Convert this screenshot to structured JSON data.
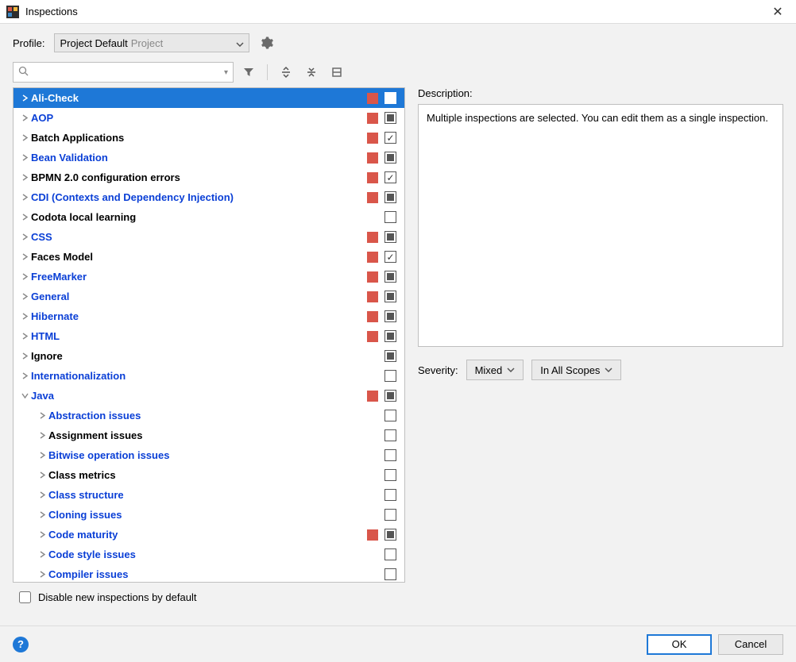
{
  "title": "Inspections",
  "profile": {
    "label": "Profile:",
    "selected": "Project Default",
    "sub": "Project"
  },
  "search": {
    "placeholder": ""
  },
  "description": {
    "label": "Description:",
    "text": "Multiple inspections are selected. You can edit them as a single inspection."
  },
  "severity": {
    "label": "Severity:",
    "value": "Mixed",
    "scope": "In All Scopes"
  },
  "disable_label": "Disable new inspections by default",
  "buttons": {
    "ok": "OK",
    "cancel": "Cancel"
  },
  "tree": [
    {
      "label": "Ali-Check",
      "link": true,
      "warn": true,
      "check": "indet",
      "selected": true,
      "expanded": false
    },
    {
      "label": "AOP",
      "link": true,
      "warn": true,
      "check": "indet"
    },
    {
      "label": "Batch Applications",
      "link": false,
      "warn": true,
      "check": "checked"
    },
    {
      "label": "Bean Validation",
      "link": true,
      "warn": true,
      "check": "indet"
    },
    {
      "label": "BPMN 2.0 configuration errors",
      "link": false,
      "warn": true,
      "check": "checked"
    },
    {
      "label": "CDI (Contexts and Dependency Injection)",
      "link": true,
      "warn": true,
      "check": "indet"
    },
    {
      "label": "Codota local learning",
      "link": false,
      "warn": false,
      "check": "empty"
    },
    {
      "label": "CSS",
      "link": true,
      "warn": true,
      "check": "indet"
    },
    {
      "label": "Faces Model",
      "link": false,
      "warn": true,
      "check": "checked"
    },
    {
      "label": "FreeMarker",
      "link": true,
      "warn": true,
      "check": "indet"
    },
    {
      "label": "General",
      "link": true,
      "warn": true,
      "check": "indet"
    },
    {
      "label": "Hibernate",
      "link": true,
      "warn": true,
      "check": "indet"
    },
    {
      "label": "HTML",
      "link": true,
      "warn": true,
      "check": "indet"
    },
    {
      "label": "Ignore",
      "link": false,
      "warn": false,
      "check": "indet"
    },
    {
      "label": "Internationalization",
      "link": true,
      "warn": false,
      "check": "empty"
    },
    {
      "label": "Java",
      "link": true,
      "warn": true,
      "check": "indet",
      "expanded": true
    },
    {
      "label": "Abstraction issues",
      "link": true,
      "warn": false,
      "check": "empty",
      "child": true
    },
    {
      "label": "Assignment issues",
      "link": false,
      "warn": false,
      "check": "empty",
      "child": true
    },
    {
      "label": "Bitwise operation issues",
      "link": true,
      "warn": false,
      "check": "empty",
      "child": true
    },
    {
      "label": "Class metrics",
      "link": false,
      "warn": false,
      "check": "empty",
      "child": true
    },
    {
      "label": "Class structure",
      "link": true,
      "warn": false,
      "check": "empty",
      "child": true
    },
    {
      "label": "Cloning issues",
      "link": true,
      "warn": false,
      "check": "empty",
      "child": true
    },
    {
      "label": "Code maturity",
      "link": true,
      "warn": true,
      "check": "indet",
      "child": true
    },
    {
      "label": "Code style issues",
      "link": true,
      "warn": false,
      "check": "empty",
      "child": true
    },
    {
      "label": "Compiler issues",
      "link": true,
      "warn": false,
      "check": "empty",
      "child": true
    }
  ]
}
